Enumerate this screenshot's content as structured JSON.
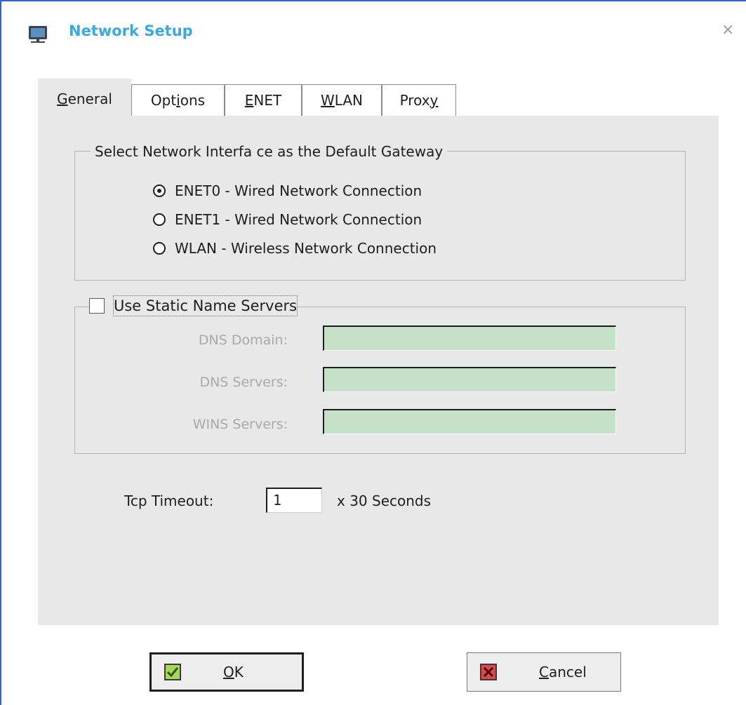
{
  "window": {
    "title": "Network Setup",
    "close_glyph": "×",
    "icon": "network-setup-icon"
  },
  "tabs": [
    {
      "label": "General",
      "mnemonic": "G",
      "active": true
    },
    {
      "label": "Options",
      "mnemonic": "i"
    },
    {
      "label": "ENET",
      "mnemonic": "E"
    },
    {
      "label": "WLAN",
      "mnemonic": "W"
    },
    {
      "label": "Proxy",
      "mnemonic": "y"
    }
  ],
  "gateway_group": {
    "legend": "Select Network Interfa ce as the Default Gateway",
    "options": [
      {
        "label": "ENET0 - Wired Network Connection",
        "selected": true
      },
      {
        "label": "ENET1 - Wired Network Connection",
        "selected": false
      },
      {
        "label": "WLAN - Wireless Network Connection",
        "selected": false
      }
    ]
  },
  "name_servers": {
    "checkbox_label": "Use Static Name Servers",
    "checked": false,
    "fields": [
      {
        "label": "DNS Domain:",
        "value": ""
      },
      {
        "label": "DNS Servers:",
        "value": ""
      },
      {
        "label": "WINS Servers:",
        "value": ""
      }
    ]
  },
  "tcp": {
    "label": "Tcp Timeout:",
    "value": "1",
    "suffix": "x  30 Seconds"
  },
  "buttons": {
    "ok": {
      "label": "OK",
      "mnemonic": "O",
      "icon": "checkmark-icon"
    },
    "cancel": {
      "label": "Cancel",
      "mnemonic": "C",
      "icon": "cross-icon"
    }
  },
  "colors": {
    "title": "#3ba8de",
    "window_border": "#2f63c4",
    "panel": "#e8e8e8",
    "field_bg": "#c5e1c8"
  }
}
